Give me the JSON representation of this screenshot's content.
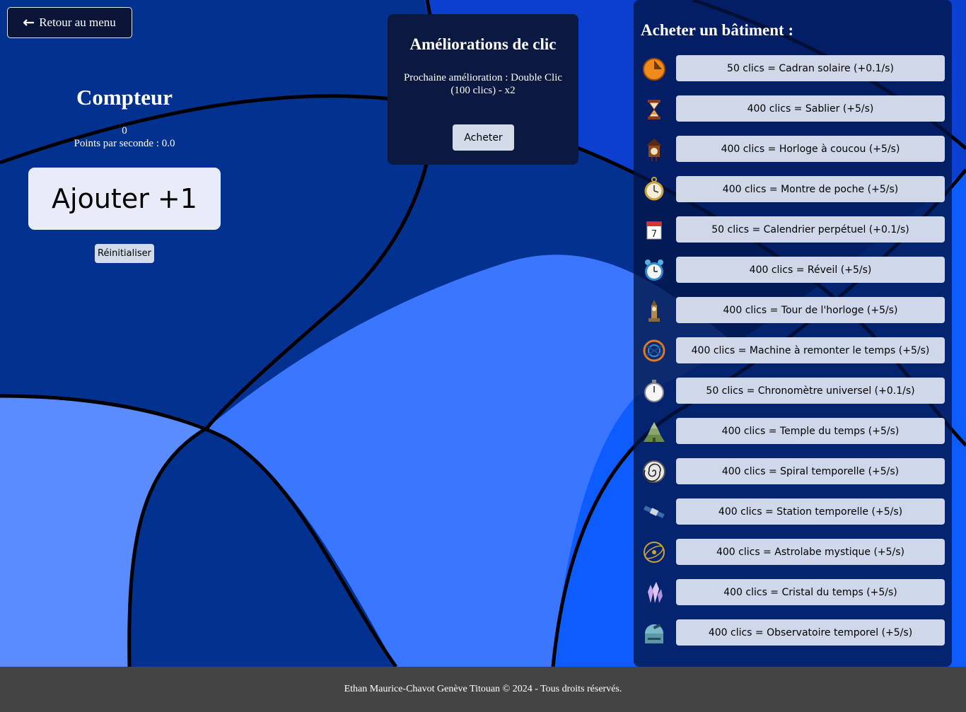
{
  "nav": {
    "back_label": "Retour au menu",
    "back_icon": "arrow-left-icon"
  },
  "counter": {
    "title": "Compteur",
    "count": "0",
    "pps": "Points par seconde : 0.0",
    "add_label": "Ajouter +1",
    "reset_label": "Réinitialiser"
  },
  "upgrades": {
    "title": "Améliorations de clic",
    "next": "Prochaine amélioration : Double Clic (100 clics) - x2",
    "buy_label": "Acheter"
  },
  "shop": {
    "title": "Acheter un bâtiment :",
    "items": [
      {
        "label": "50 clics = Cadran solaire (+0.1/s)",
        "icon": "sundial-icon"
      },
      {
        "label": "400 clics = Sablier (+5/s)",
        "icon": "hourglass-icon"
      },
      {
        "label": "400 clics = Horloge à coucou (+5/s)",
        "icon": "cuckoo-clock-icon"
      },
      {
        "label": "400 clics = Montre de poche (+5/s)",
        "icon": "pocket-watch-icon"
      },
      {
        "label": "50 clics = Calendrier perpétuel (+0.1/s)",
        "icon": "calendar-icon"
      },
      {
        "label": "400 clics = Réveil (+5/s)",
        "icon": "alarm-clock-icon"
      },
      {
        "label": "400 clics = Tour de l'horloge (+5/s)",
        "icon": "clock-tower-icon"
      },
      {
        "label": "400 clics = Machine à remonter le temps (+5/s)",
        "icon": "time-machine-icon"
      },
      {
        "label": "50 clics = Chronomètre universel (+0.1/s)",
        "icon": "stopwatch-icon"
      },
      {
        "label": "400 clics = Temple du temps (+5/s)",
        "icon": "temple-icon"
      },
      {
        "label": "400 clics = Spiral temporelle (+5/s)",
        "icon": "spiral-icon"
      },
      {
        "label": "400 clics = Station temporelle (+5/s)",
        "icon": "space-station-icon"
      },
      {
        "label": "400 clics = Astrolabe mystique (+5/s)",
        "icon": "astrolabe-icon"
      },
      {
        "label": "400 clics = Cristal du temps (+5/s)",
        "icon": "crystal-icon"
      },
      {
        "label": "400 clics = Observatoire temporel (+5/s)",
        "icon": "observatory-icon"
      }
    ]
  },
  "footer": {
    "text": "Ethan Maurice-Chavot Genève Titouan © 2024 - Tous droits réservés."
  },
  "colors": {
    "page_blue": "#0a3fd0",
    "dark_blue": "#02318f",
    "light_blue": "#3a76ff",
    "panel": "#0b1840",
    "footer": "#444444"
  }
}
